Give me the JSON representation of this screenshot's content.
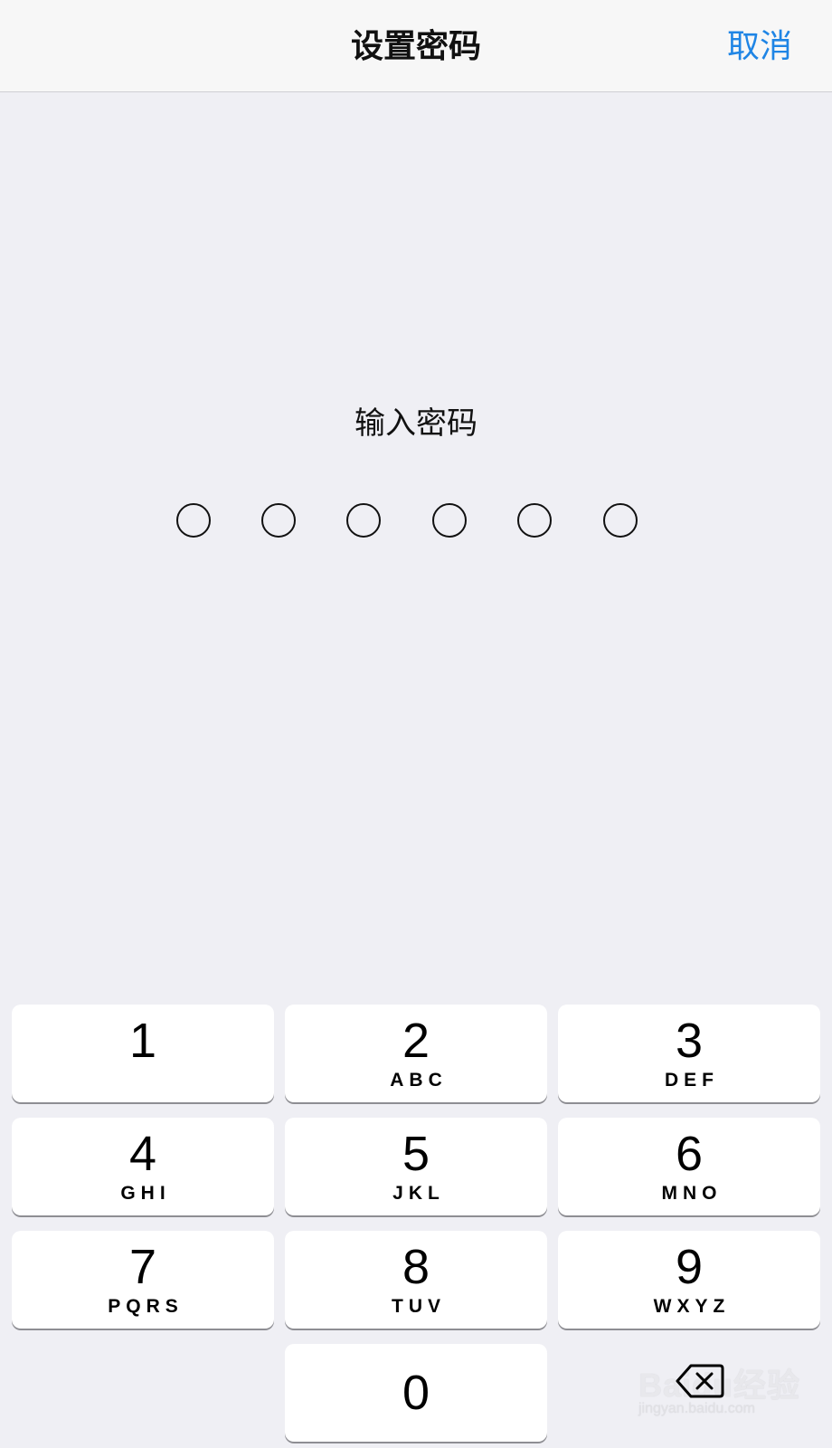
{
  "nav": {
    "title": "设置密码",
    "cancel_label": "取消"
  },
  "prompt": "输入密码",
  "passcode": {
    "length": 6,
    "filled": 0
  },
  "keys": [
    {
      "digit": "1",
      "letters": ""
    },
    {
      "digit": "2",
      "letters": "ABC"
    },
    {
      "digit": "3",
      "letters": "DEF"
    },
    {
      "digit": "4",
      "letters": "GHI"
    },
    {
      "digit": "5",
      "letters": "JKL"
    },
    {
      "digit": "6",
      "letters": "MNO"
    },
    {
      "digit": "7",
      "letters": "PQRS"
    },
    {
      "digit": "8",
      "letters": "TUV"
    },
    {
      "digit": "9",
      "letters": "WXYZ"
    },
    {
      "digit": "0",
      "letters": ""
    }
  ],
  "icons": {
    "backspace": "delete-left-icon"
  },
  "watermark": {
    "logo": "Baidu经验",
    "url": "jingyan.baidu.com"
  },
  "colors": {
    "accent": "#1f85e5",
    "background": "#efeff4",
    "navbar": "#f7f7f7",
    "key": "#ffffff"
  }
}
